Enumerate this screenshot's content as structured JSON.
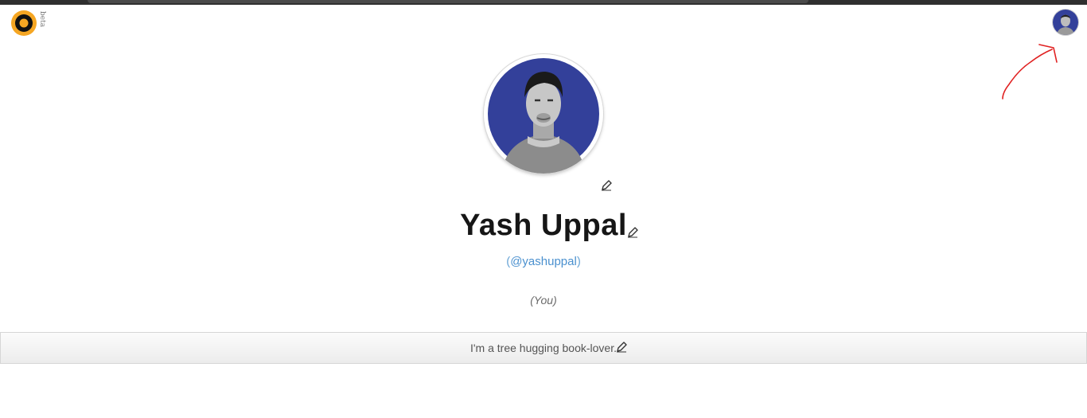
{
  "header": {
    "beta_label": "beta",
    "logo_icon": "circle-logo-icon",
    "logo_colors": {
      "outer": "#f5a623",
      "ring": "#111111",
      "center": "#f5a623"
    },
    "user_avatar_icon": "user-avatar-icon"
  },
  "profile": {
    "name": "Yash Uppal",
    "username": "@yashuppal",
    "you_label": "(You)",
    "bio": "I'm a tree hugging book-lover.",
    "photo_bg_color": "#33409a",
    "edit_icon": "pencil-icon"
  },
  "annotation": {
    "arrow_color": "#e02020",
    "arrow_icon": "red-arrow-annotation"
  },
  "colors": {
    "link": "#4a90cf",
    "name": "#161616",
    "bio_text": "#555555"
  }
}
